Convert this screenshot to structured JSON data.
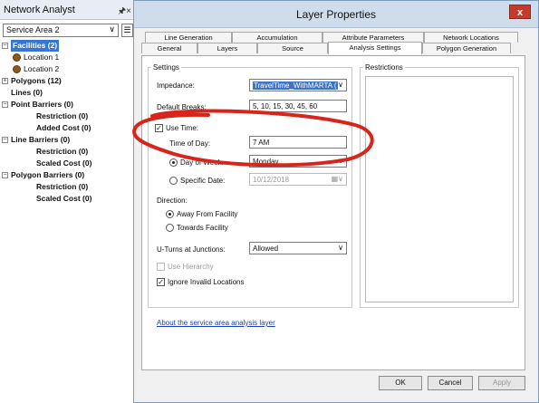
{
  "network_analyst": {
    "title": "Network Analyst",
    "pin_close": " ×",
    "layer_select": "Service Area 2",
    "tree": [
      {
        "label": "Facilities (2)",
        "level": 0,
        "expander": "−",
        "selected": true
      },
      {
        "label": "Location 1",
        "level": 1,
        "marker": "brown-point-icon"
      },
      {
        "label": "Location 2",
        "level": 1,
        "marker": "brown-point-icon"
      },
      {
        "label": "Polygons (12)",
        "level": 0,
        "expander": "+"
      },
      {
        "label": "Lines (0)",
        "level": 0
      },
      {
        "label": "Point Barriers (0)",
        "level": 0,
        "expander": "−"
      },
      {
        "label": "Restriction (0)",
        "level": 2
      },
      {
        "label": "Added Cost (0)",
        "level": 2
      },
      {
        "label": "Line Barriers (0)",
        "level": 0,
        "expander": "−"
      },
      {
        "label": "Restriction (0)",
        "level": 2
      },
      {
        "label": "Scaled Cost (0)",
        "level": 2
      },
      {
        "label": "Polygon Barriers (0)",
        "level": 0,
        "expander": "−"
      },
      {
        "label": "Restriction (0)",
        "level": 2
      },
      {
        "label": "Scaled Cost (0)",
        "level": 2
      }
    ]
  },
  "dialog": {
    "title": "Layer Properties",
    "close": "x",
    "tabs_row1": [
      "Line Generation",
      "Accumulation",
      "Attribute Parameters",
      "Network Locations"
    ],
    "tabs_row2": [
      "General",
      "Layers",
      "Source",
      "Analysis Settings",
      "Polygon Generation"
    ],
    "active_tab": "Analysis Settings",
    "settings": {
      "legend": "Settings",
      "impedance_label": "Impedance:",
      "impedance_value": "TravelTime_WithMARTA (",
      "breaks_label": "Default Breaks:",
      "breaks_value": "5, 10, 15, 30, 45, 60",
      "use_time_label": "Use Time:",
      "use_time_checked": true,
      "time_label": "Time of Day:",
      "time_value": "7 AM",
      "day_label": "Day of Week:",
      "day_value": "Monday",
      "date_label": "Specific Date:",
      "date_value": "10/12/2018",
      "direction_label": "Direction:",
      "away_label": "Away From Facility",
      "towards_label": "Towards Facility",
      "uturn_label": "U-Turns at Junctions:",
      "uturn_value": "Allowed",
      "hierarchy_label": "Use Hierarchy",
      "ignore_label": "Ignore Invalid Locations",
      "ignore_checked": true
    },
    "restrictions_legend": "Restrictions",
    "about_link": "About the service area analysis layer",
    "buttons": {
      "ok": "OK",
      "cancel": "Cancel",
      "apply": "Apply"
    }
  },
  "colors": {
    "annotation": "#d8251b",
    "selection": "#3876d4"
  }
}
